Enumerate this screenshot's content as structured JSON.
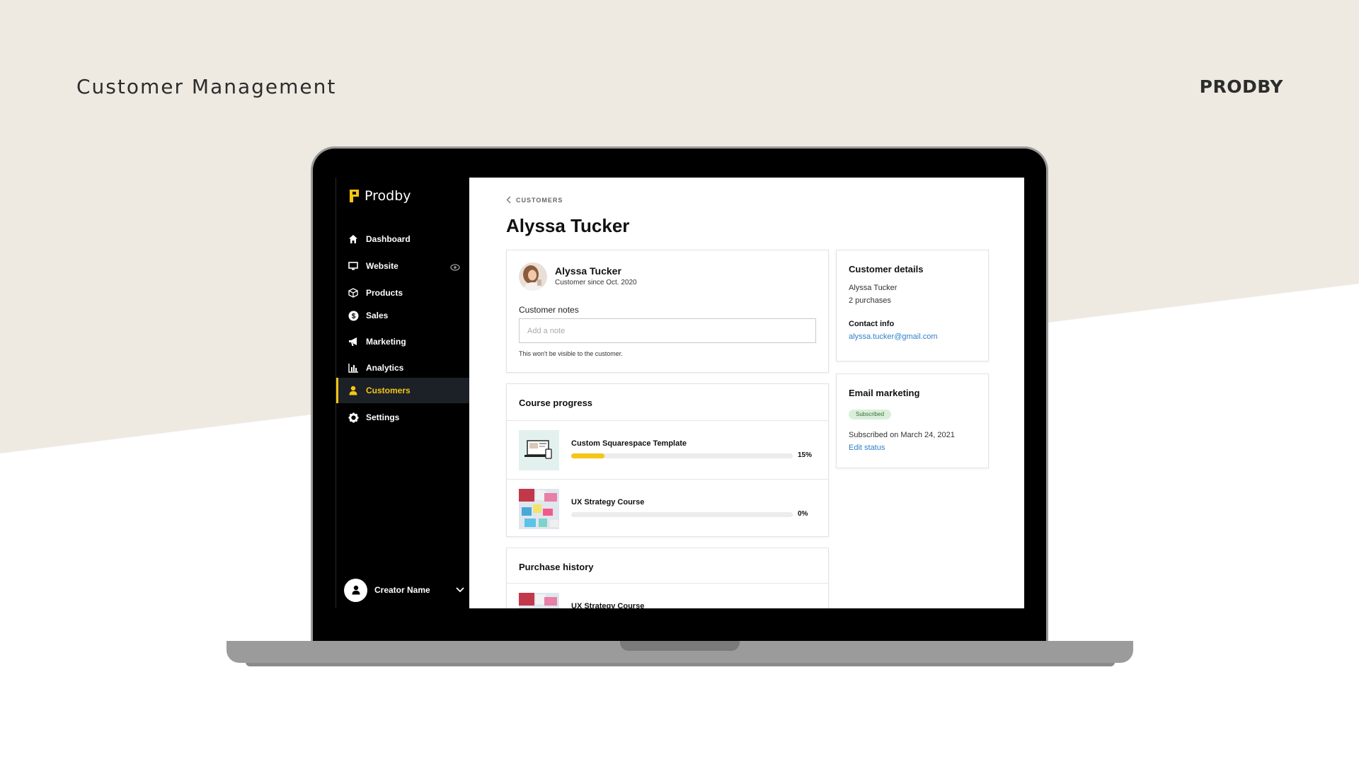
{
  "slide": {
    "title": "Customer Management",
    "brand": "PRODBY"
  },
  "app": {
    "logo_text": "Prodby"
  },
  "sidebar": {
    "items": [
      {
        "label": "Dashboard",
        "icon": "home-icon",
        "active": false
      },
      {
        "label": "Website",
        "icon": "monitor-icon",
        "active": false
      },
      {
        "label": "Products",
        "icon": "box-icon",
        "active": false
      },
      {
        "label": "Sales",
        "icon": "dollar-icon",
        "active": false
      },
      {
        "label": "Marketing",
        "icon": "megaphone-icon",
        "active": false
      },
      {
        "label": "Analytics",
        "icon": "bar-chart-icon",
        "active": false
      },
      {
        "label": "Customers",
        "icon": "user-icon",
        "active": true
      },
      {
        "label": "Settings",
        "icon": "gear-icon",
        "active": false
      }
    ],
    "user_name": "Creator Name"
  },
  "main": {
    "breadcrumb": "CUSTOMERS",
    "page_title": "Alyssa Tucker",
    "profile": {
      "name": "Alyssa Tucker",
      "since": "Customer since Oct. 2020",
      "notes_label": "Customer notes",
      "notes_placeholder": "Add a note",
      "notes_hint": "This won't be visible to the customer."
    },
    "course_progress": {
      "title": "Course progress",
      "courses": [
        {
          "name": "Custom Squarespace Template",
          "progress_pct": 15,
          "progress_label": "15%"
        },
        {
          "name": "UX Strategy Course",
          "progress_pct": 0,
          "progress_label": "0%"
        }
      ]
    },
    "purchase_history": {
      "title": "Purchase history",
      "items": [
        {
          "name": "UX Strategy Course"
        }
      ]
    },
    "customer_details": {
      "title": "Customer details",
      "name": "Alyssa Tucker",
      "purchases": "2 purchases",
      "contact_title": "Contact info",
      "email": "alyssa.tucker@gmail.com"
    },
    "email_marketing": {
      "title": "Email marketing",
      "status_badge": "Subscribed",
      "subscribed_on": "Subscribed on March 24, 2021",
      "edit_link": "Edit status"
    }
  },
  "colors": {
    "accent": "#f5c518",
    "beige": "#eeeae1",
    "link": "#2f80c9"
  }
}
